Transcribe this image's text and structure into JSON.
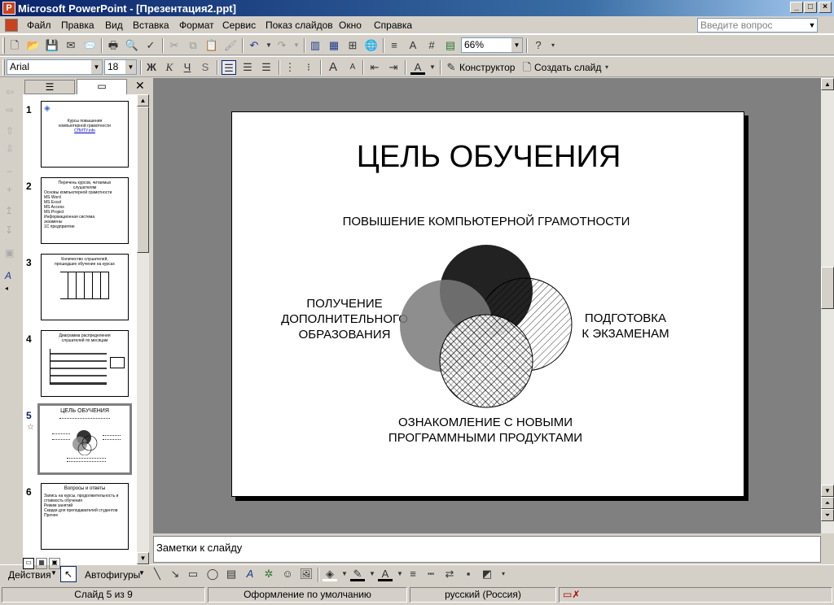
{
  "window": {
    "title": "Microsoft PowerPoint - [Презентация2.ppt]",
    "min": "_",
    "max": "□",
    "close": "×"
  },
  "menu": {
    "items": [
      "Файл",
      "Правка",
      "Вид",
      "Вставка",
      "Формат",
      "Сервис",
      "Показ слайдов",
      "Окно",
      "Справка"
    ],
    "ask_placeholder": "Введите вопрос"
  },
  "toolbar": {
    "zoom": "66%",
    "font": "Arial",
    "size": "18",
    "bold": "Ж",
    "italic": "К",
    "underline": "Ч",
    "shadow": "S",
    "designer": "Конструктор",
    "new_slide": "Создать слайд"
  },
  "thumbs": [
    {
      "num": "1",
      "line1": "Курсы повышения",
      "line2": "компьютерной грамотности",
      "link": "СПИТУ.info"
    },
    {
      "num": "2",
      "line1": "Перечень курсов, читаемых",
      "line2": "слушателям",
      "items": [
        "Основы компьютерной грамотности",
        "MS Word",
        "MS Excel",
        "MS Access",
        "MS Project",
        "Информационная система",
        "экзамены",
        "1С предприятие"
      ]
    },
    {
      "num": "3",
      "line1": "Количество слушателей,",
      "line2": "прошедших обучение на курсах"
    },
    {
      "num": "4",
      "line1": "Диаграмма распределения",
      "line2": "слушателей по месяцам"
    },
    {
      "num": "5",
      "line1": "ЦЕЛЬ ОБУЧЕНИЯ",
      "line2": ""
    },
    {
      "num": "6",
      "line1": "Вопросы и ответы",
      "line2": "",
      "items": [
        "Запись на курсы, продолжительность и стоимость обучения",
        "Режим занятий",
        "Скидки для преподавателей студентов",
        "Прочее"
      ]
    }
  ],
  "slide": {
    "title": "ЦЕЛЬ ОБУЧЕНИЯ",
    "top_label": "ПОВЫШЕНИЕ КОМПЬЮТЕРНОЙ ГРАМОТНОСТИ",
    "left_label": [
      "ПОЛУЧЕНИЕ",
      "ДОПОЛНИТЕЛЬНОГО",
      "ОБРАЗОВАНИЯ"
    ],
    "right_label": [
      "ПОДГОТОВКА",
      "К ЭКЗАМЕНАМ"
    ],
    "bottom_label": [
      "ОЗНАКОМЛЕНИЕ С НОВЫМИ",
      "ПРОГРАММНЫМИ ПРОДУКТАМИ"
    ]
  },
  "notes": "Заметки к слайду",
  "drawbar": {
    "actions": "Действия",
    "autoshapes": "Автофигуры"
  },
  "status": {
    "slide": "Слайд 5 из 9",
    "design": "Оформление по умолчанию",
    "lang": "русский (Россия)"
  }
}
